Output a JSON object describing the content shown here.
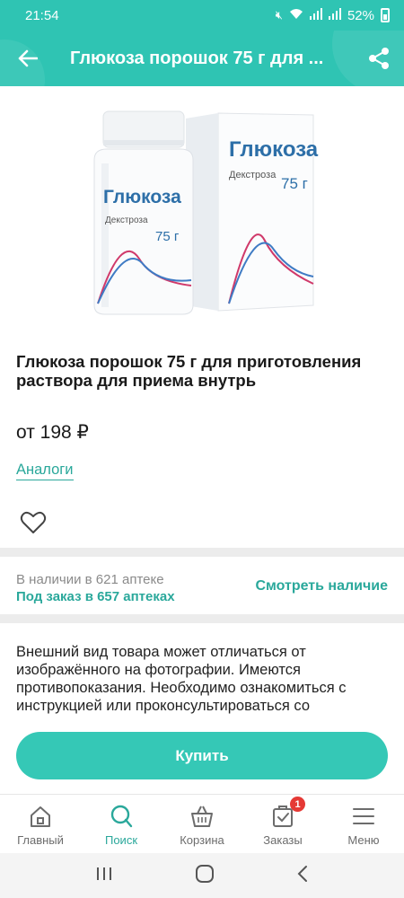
{
  "status_bar": {
    "time": "21:54",
    "battery": "52%"
  },
  "app_bar": {
    "title": "Глюкоза порошок 75 г для ..."
  },
  "product": {
    "box_brand": "Глюкоза",
    "box_subtitle": "Декстроза",
    "box_dose": "75 г",
    "title": "Глюкоза порошок 75 г для приготовления раствора для приема внутрь",
    "price": "от 198 ₽",
    "analogs_label": "Аналоги"
  },
  "availability": {
    "in_stock": "В наличии в 621 аптеке",
    "on_order": "Под заказ в 657 аптеках",
    "check_label": "Смотреть наличие"
  },
  "disclaimer": "Внешний вид товара может отличаться от изображённого на фотографии. Имеются противопоказания. Необходимо ознакомиться с инструкцией или проконсультироваться со специалистом.",
  "buy_label": "Купить",
  "bottom_nav": {
    "items": [
      {
        "label": "Главный",
        "icon": "home-icon"
      },
      {
        "label": "Поиск",
        "icon": "search-icon",
        "active": true
      },
      {
        "label": "Корзина",
        "icon": "basket-icon"
      },
      {
        "label": "Заказы",
        "icon": "orders-icon",
        "badge": "1"
      },
      {
        "label": "Меню",
        "icon": "menu-icon"
      }
    ]
  },
  "colors": {
    "accent": "#2fc4b3",
    "link": "#2aa89b",
    "badge": "#e53935"
  }
}
